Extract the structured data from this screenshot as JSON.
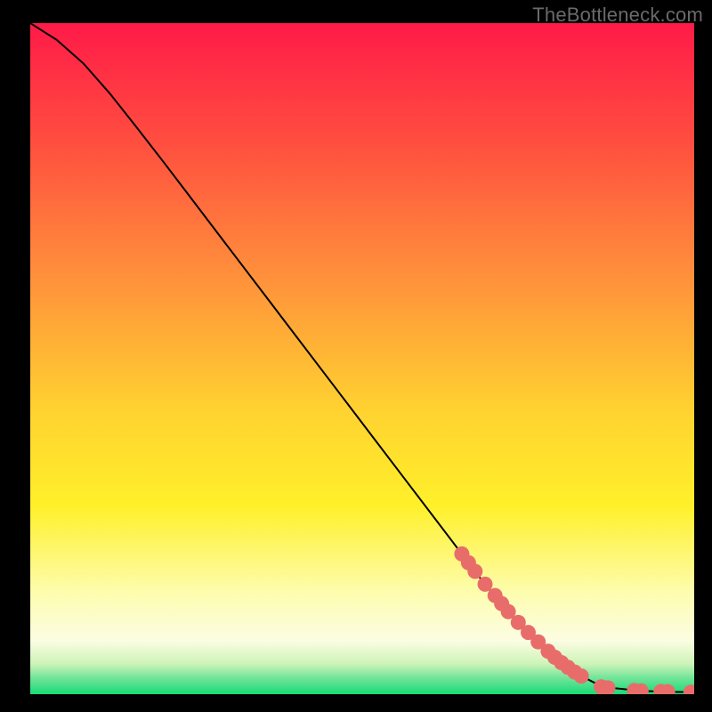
{
  "attribution": "TheBottleneck.com",
  "colors": {
    "curve": "#000000",
    "marker": "#e86d6a",
    "gradient_top": "#ff1a48",
    "gradient_mid": "#ffe22a",
    "gradient_low": "#fffcd0",
    "gradient_bottom": "#19e07a",
    "frame": "#000000"
  },
  "chart_data": {
    "type": "line",
    "title": "",
    "xlabel": "",
    "ylabel": "",
    "xlim": [
      0,
      100
    ],
    "ylim": [
      0,
      100
    ],
    "curve": {
      "x": [
        0,
        4,
        8,
        12,
        16,
        20,
        24,
        28,
        32,
        36,
        40,
        44,
        48,
        52,
        56,
        60,
        64,
        68,
        72,
        76,
        78,
        80,
        81.5,
        83,
        85,
        88,
        92,
        96,
        100
      ],
      "y": [
        100,
        97.5,
        94,
        89.5,
        84.5,
        79.4,
        74.2,
        69,
        63.8,
        58.6,
        53.4,
        48.2,
        43,
        37.8,
        32.6,
        27.4,
        22.2,
        17,
        12.2,
        8.1,
        6.3,
        4.7,
        3.6,
        2.7,
        1.7,
        0.9,
        0.5,
        0.35,
        0.3
      ]
    },
    "markers": {
      "x": [
        65,
        66,
        67,
        68.5,
        70,
        71,
        72,
        73.5,
        75,
        76.5,
        78,
        79,
        80,
        81,
        82,
        83,
        86,
        87,
        91,
        92,
        95,
        96,
        99.5
      ],
      "y": [
        20.9,
        19.6,
        18.3,
        16.4,
        14.7,
        13.5,
        12.3,
        10.7,
        9.2,
        7.8,
        6.4,
        5.5,
        4.7,
        4.0,
        3.3,
        2.7,
        1.1,
        0.95,
        0.55,
        0.5,
        0.4,
        0.38,
        0.3
      ]
    }
  }
}
